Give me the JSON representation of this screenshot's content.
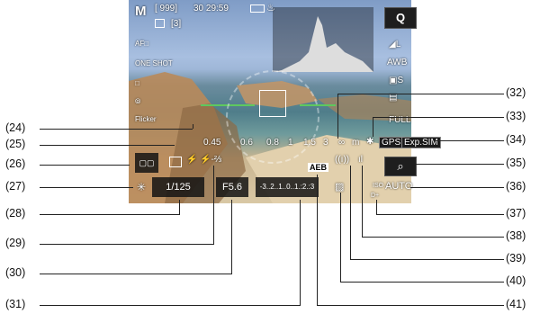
{
  "top_bar": {
    "mode": "M",
    "shots_remaining": "[ 999]",
    "time": "30 29:59",
    "drive_bracket": "[3]"
  },
  "side_icons": [
    "AF□",
    "ONE SHOT",
    "□",
    "⦾",
    "Flicker"
  ],
  "right_panel": {
    "q_button": "Q",
    "quality": "◢L",
    "wb": "AWB",
    "picture_style": "▣S",
    "full": "FULL",
    "gps": "GPS",
    "exp_sim": "Exp.SIM",
    "zoom": "⌕",
    "iso": "AUTO"
  },
  "scale_numbers": [
    "0.45",
    "0.6",
    "0.8",
    "1",
    "1.5",
    "3",
    "∞",
    "m"
  ],
  "flash_comp": "⚡-⅔",
  "exposure_scale": "-3..2..1..0..1.:2.:3",
  "shutter_speed": "1/125",
  "aperture": "F5.6",
  "aeb": "AEB",
  "callouts_left": [
    "(24)",
    "(25)",
    "(26)",
    "(27)",
    "(28)",
    "(29)",
    "(30)",
    "(31)"
  ],
  "callouts_right": [
    "(32)",
    "(33)",
    "(34)",
    "(35)",
    "(36)",
    "(37)",
    "(38)",
    "(39)",
    "(40)",
    "(41)"
  ],
  "colors": {
    "accent": "#ffffff",
    "panel": "#1e1e1e"
  }
}
